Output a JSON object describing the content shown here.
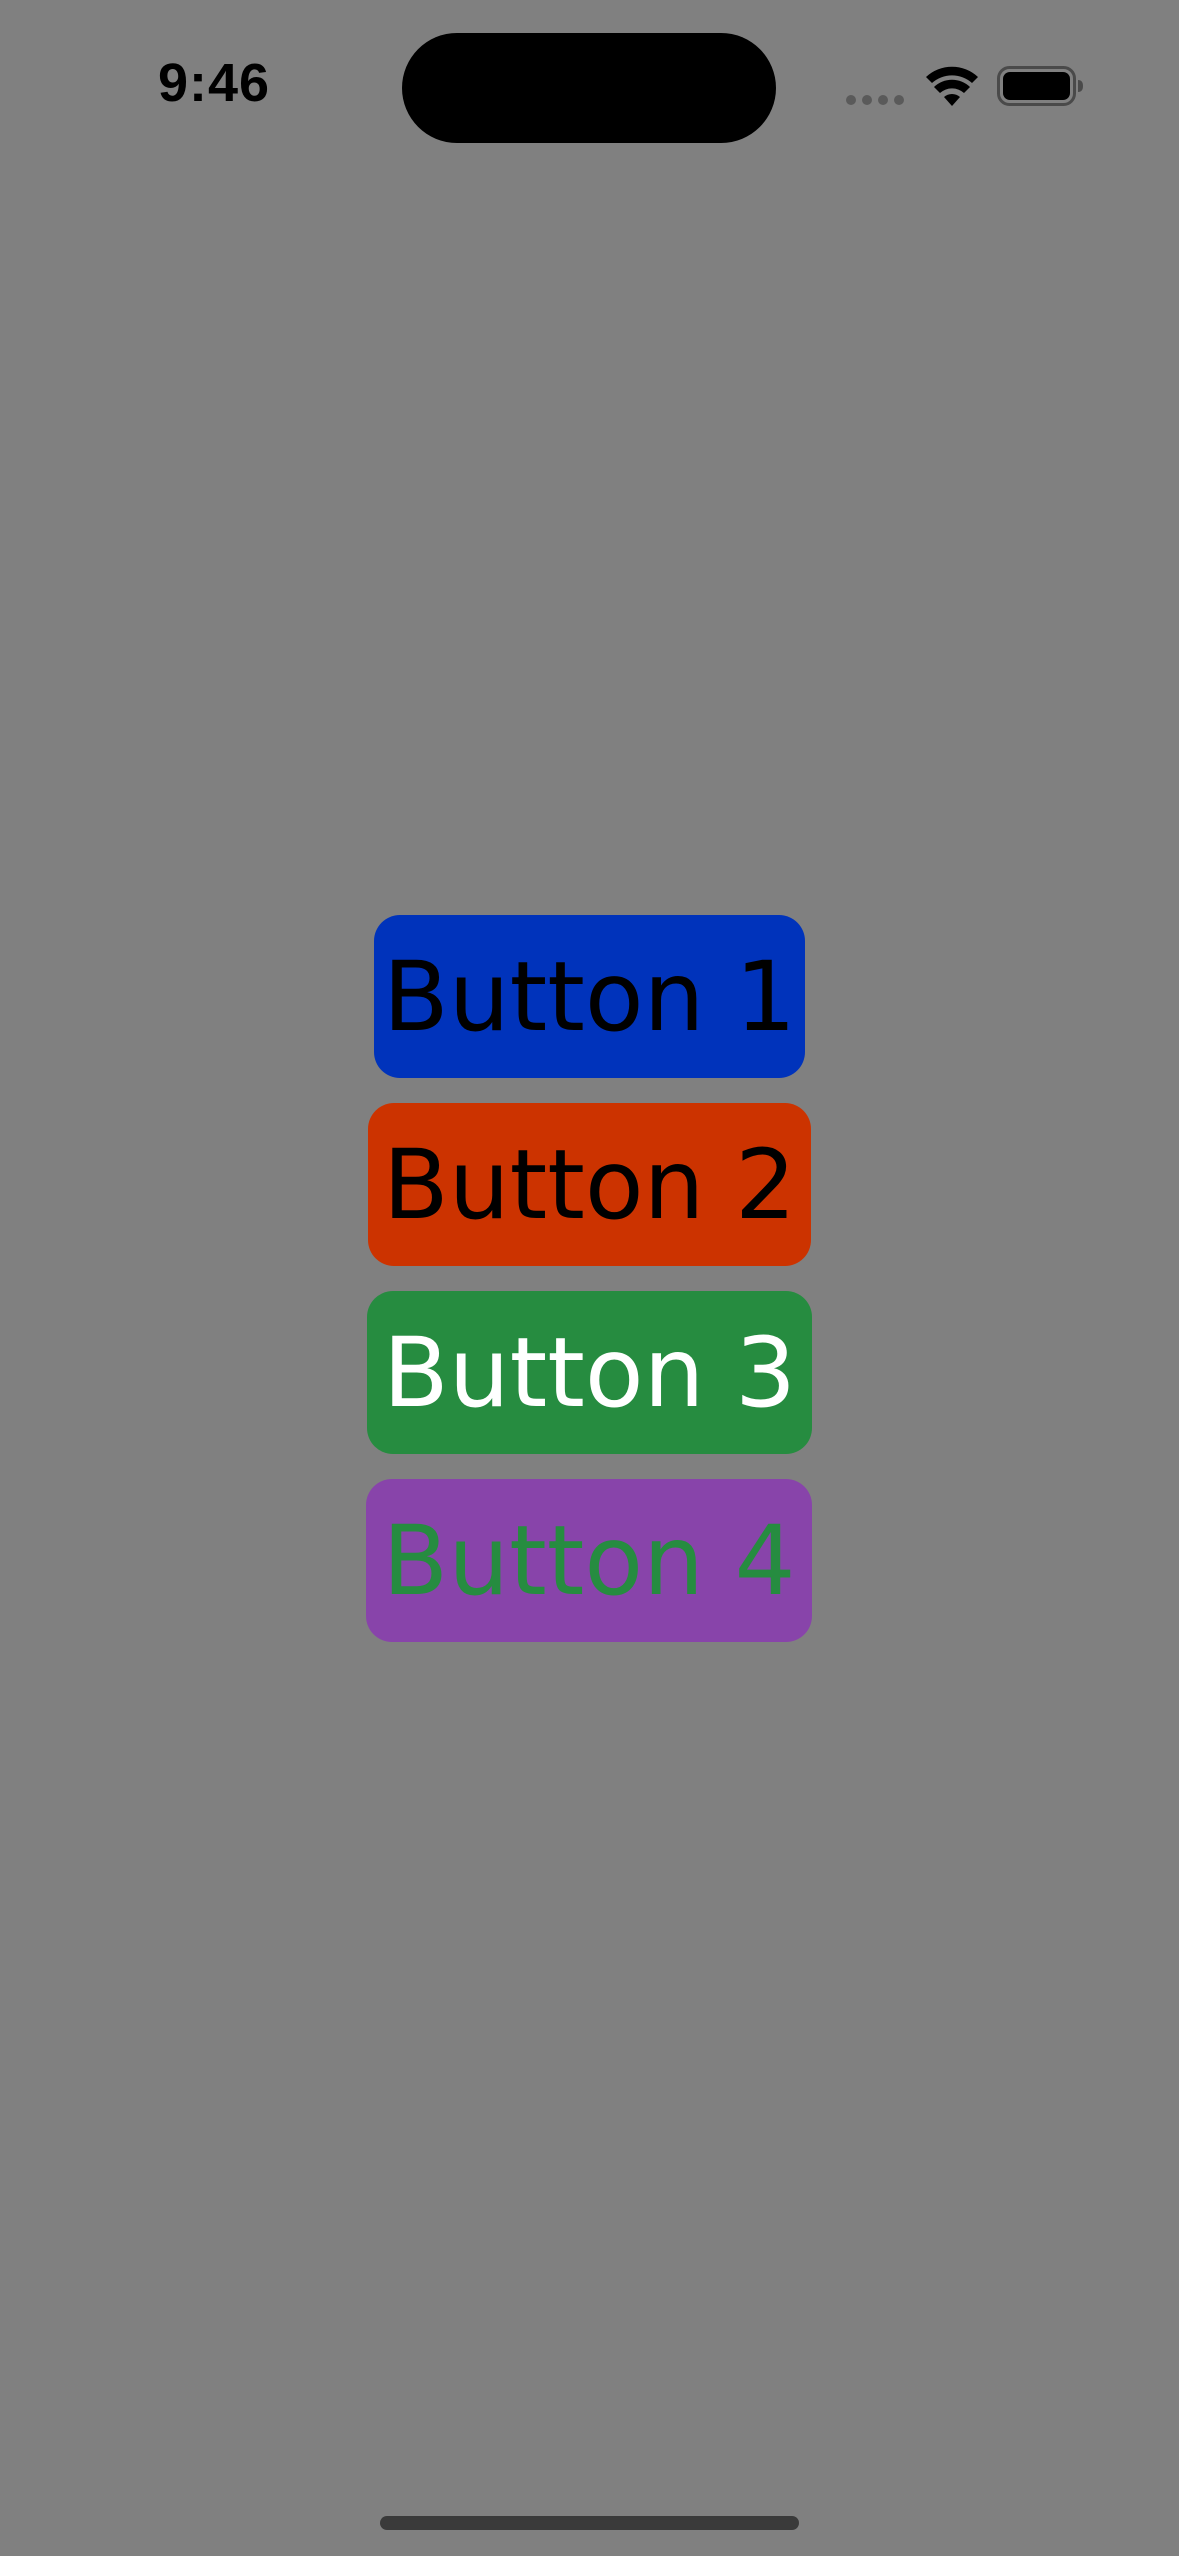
{
  "status_bar": {
    "time": "9:46",
    "icons": [
      "signal-dots-icon",
      "wifi-icon",
      "battery-icon"
    ]
  },
  "buttons": [
    {
      "label": "Button 1",
      "background": "#0033BB",
      "text_color": "#000000"
    },
    {
      "label": "Button 2",
      "background": "#CC3300",
      "text_color": "#000000"
    },
    {
      "label": "Button 3",
      "background": "#268C40",
      "text_color": "#FFFFFF"
    },
    {
      "label": "Button 4",
      "background": "#8844AA",
      "text_color": "#268C40"
    }
  ],
  "colors": {
    "background": "#808080"
  }
}
